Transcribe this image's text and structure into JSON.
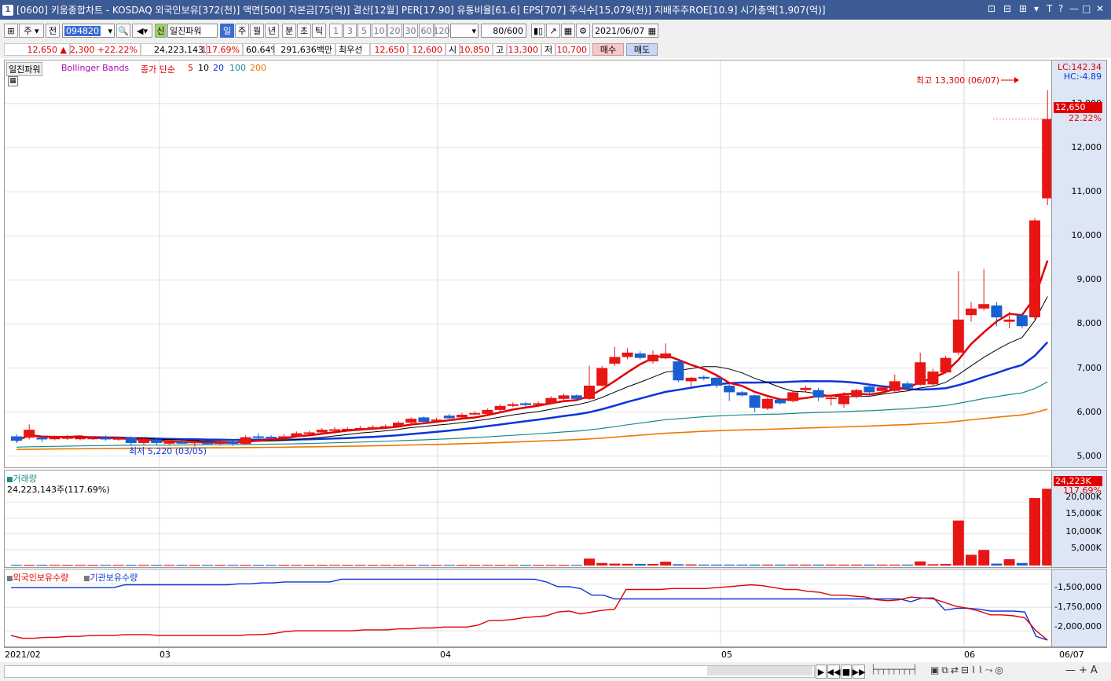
{
  "window": {
    "num": "1",
    "title": "[0600] 키움종합차트 - KOSDAQ 외국인보유[372(천)] 액면[500] 자본금[75(억)] 결산[12월] PER[17.90] 유통비율[61.6] EPS[707] 주식수[15,079(천)] 지배주주ROE[10.9] 시가총액[1,907(억)]",
    "controls": [
      "⊡",
      "⊟",
      "⊞",
      "▾",
      "T",
      "?",
      "—",
      "□",
      "✕"
    ]
  },
  "toolbar": {
    "market": "주",
    "prev": "전",
    "code": "094820",
    "shin": "신",
    "indicator": "일진파워",
    "periods": [
      "일",
      "주",
      "월",
      "년",
      "분",
      "초",
      "틱"
    ],
    "selected_period": "일",
    "nums": [
      "1",
      "3",
      "5",
      "10",
      "20",
      "30",
      "60",
      "120"
    ],
    "count": "80/600",
    "date": "2021/06/07"
  },
  "info": {
    "price": "12,650",
    "arrow": "▲",
    "change": "2,300",
    "rate": "+22.22%",
    "volume": "24,223,143",
    "vol_rate": "117.69%",
    "ratio": "60.64%",
    "amount": "291,636백만",
    "best_label": "최우선",
    "bid": "12,650",
    "ask": "12,600",
    "open_label": "시",
    "open": "10,850",
    "high_label": "고",
    "high": "13,300",
    "low_label": "저",
    "low": "10,700",
    "buy": "매수",
    "sell": "매도"
  },
  "price_panel": {
    "legend_name": "일진파워",
    "bb": "Bollinger Bands",
    "ma_label": "종가 단순",
    "ma_periods": [
      "5",
      "10",
      "20",
      "100",
      "200"
    ],
    "ma_colors": [
      "#e00000",
      "#000000",
      "#0a35d8",
      "#1a8a8a",
      "#ee7700"
    ],
    "lc": "LC:142.34",
    "hc": "HC:-4.89",
    "high_note": "최고 13,300 (06/07)",
    "low_note": "최저 5,220 (03/05)",
    "last_price": "12,650",
    "last_rate": "22.22%"
  },
  "volume_panel": {
    "title": "거래량",
    "value": "24,223,143주(117.69%)",
    "last": "24,223K",
    "last_rate": "117.69%",
    "ticks": [
      "20,000K",
      "15,000K",
      "10,000K",
      "5,000K"
    ]
  },
  "holding_panel": {
    "foreign_label": "외국인보유수량",
    "inst_label": "기관보유수량",
    "ticks": [
      "-1,500,000",
      "-1,750,000",
      "-2,000,000"
    ]
  },
  "x_labels": [
    "2021/02",
    "03",
    "04",
    "05",
    "06",
    "06/07"
  ],
  "chart_data": {
    "type": "candlestick",
    "y_ticks": [
      13000,
      12000,
      11000,
      10000,
      9000,
      8000,
      7000,
      6000,
      5000
    ],
    "ylim": [
      4800,
      13800
    ],
    "candles": [
      {
        "o": 5450,
        "c": 5350,
        "h": 5500,
        "l": 5300
      },
      {
        "o": 5420,
        "c": 5600,
        "h": 5720,
        "l": 5380
      },
      {
        "o": 5420,
        "c": 5380,
        "h": 5460,
        "l": 5320
      },
      {
        "o": 5400,
        "c": 5420,
        "h": 5470,
        "l": 5360
      },
      {
        "o": 5400,
        "c": 5430,
        "h": 5480,
        "l": 5370
      },
      {
        "o": 5400,
        "c": 5420,
        "h": 5470,
        "l": 5360
      },
      {
        "o": 5400,
        "c": 5420,
        "h": 5460,
        "l": 5370
      },
      {
        "o": 5420,
        "c": 5380,
        "h": 5470,
        "l": 5350
      },
      {
        "o": 5380,
        "c": 5410,
        "h": 5440,
        "l": 5350
      },
      {
        "o": 5420,
        "c": 5300,
        "h": 5450,
        "l": 5250
      },
      {
        "o": 5300,
        "c": 5380,
        "h": 5420,
        "l": 5260
      },
      {
        "o": 5380,
        "c": 5300,
        "h": 5420,
        "l": 5260
      },
      {
        "o": 5300,
        "c": 5320,
        "h": 5360,
        "l": 5250
      },
      {
        "o": 5320,
        "c": 5300,
        "h": 5360,
        "l": 5280
      },
      {
        "o": 5300,
        "c": 5330,
        "h": 5360,
        "l": 5220
      },
      {
        "o": 5310,
        "c": 5300,
        "h": 5340,
        "l": 5260
      },
      {
        "o": 5280,
        "c": 5320,
        "h": 5360,
        "l": 5250
      },
      {
        "o": 5320,
        "c": 5280,
        "h": 5350,
        "l": 5240
      },
      {
        "o": 5280,
        "c": 5430,
        "h": 5470,
        "l": 5260
      },
      {
        "o": 5450,
        "c": 5420,
        "h": 5520,
        "l": 5380
      },
      {
        "o": 5440,
        "c": 5430,
        "h": 5480,
        "l": 5400
      },
      {
        "o": 5420,
        "c": 5450,
        "h": 5500,
        "l": 5390
      },
      {
        "o": 5450,
        "c": 5520,
        "h": 5560,
        "l": 5430
      },
      {
        "o": 5520,
        "c": 5540,
        "h": 5580,
        "l": 5480
      },
      {
        "o": 5540,
        "c": 5600,
        "h": 5640,
        "l": 5520
      },
      {
        "o": 5600,
        "c": 5610,
        "h": 5660,
        "l": 5560
      },
      {
        "o": 5610,
        "c": 5620,
        "h": 5660,
        "l": 5580
      },
      {
        "o": 5620,
        "c": 5640,
        "h": 5690,
        "l": 5590
      },
      {
        "o": 5640,
        "c": 5660,
        "h": 5700,
        "l": 5610
      },
      {
        "o": 5660,
        "c": 5680,
        "h": 5720,
        "l": 5630
      },
      {
        "o": 5680,
        "c": 5760,
        "h": 5800,
        "l": 5650
      },
      {
        "o": 5760,
        "c": 5850,
        "h": 5880,
        "l": 5730
      },
      {
        "o": 5880,
        "c": 5780,
        "h": 5900,
        "l": 5740
      },
      {
        "o": 5800,
        "c": 5830,
        "h": 5870,
        "l": 5770
      },
      {
        "o": 5920,
        "c": 5860,
        "h": 5960,
        "l": 5820
      },
      {
        "o": 5880,
        "c": 5940,
        "h": 5980,
        "l": 5860
      },
      {
        "o": 5960,
        "c": 5980,
        "h": 6020,
        "l": 5930
      },
      {
        "o": 5960,
        "c": 6050,
        "h": 6080,
        "l": 5940
      },
      {
        "o": 6050,
        "c": 6140,
        "h": 6180,
        "l": 6010
      },
      {
        "o": 6140,
        "c": 6180,
        "h": 6220,
        "l": 6110
      },
      {
        "o": 6200,
        "c": 6160,
        "h": 6230,
        "l": 6120
      },
      {
        "o": 6180,
        "c": 6200,
        "h": 6240,
        "l": 6150
      },
      {
        "o": 6200,
        "c": 6320,
        "h": 6360,
        "l": 6180
      },
      {
        "o": 6300,
        "c": 6380,
        "h": 6420,
        "l": 6270
      },
      {
        "o": 6380,
        "c": 6300,
        "h": 6400,
        "l": 6250
      },
      {
        "o": 6300,
        "c": 6600,
        "h": 7050,
        "l": 6280
      },
      {
        "o": 6600,
        "c": 7000,
        "h": 7050,
        "l": 6580
      },
      {
        "o": 7100,
        "c": 7250,
        "h": 7480,
        "l": 7050
      },
      {
        "o": 7250,
        "c": 7350,
        "h": 7450,
        "l": 7200
      },
      {
        "o": 7330,
        "c": 7230,
        "h": 7380,
        "l": 7200
      },
      {
        "o": 7150,
        "c": 7300,
        "h": 7400,
        "l": 7100
      },
      {
        "o": 7220,
        "c": 7330,
        "h": 7560,
        "l": 7200
      },
      {
        "o": 7150,
        "c": 6720,
        "h": 7180,
        "l": 6680
      },
      {
        "o": 6700,
        "c": 6780,
        "h": 6800,
        "l": 6580
      },
      {
        "o": 6800,
        "c": 6760,
        "h": 6830,
        "l": 6720
      },
      {
        "o": 6780,
        "c": 6600,
        "h": 6820,
        "l": 6550
      },
      {
        "o": 6600,
        "c": 6450,
        "h": 6640,
        "l": 6250
      },
      {
        "o": 6450,
        "c": 6380,
        "h": 6480,
        "l": 6350
      },
      {
        "o": 6380,
        "c": 6100,
        "h": 6400,
        "l": 6000
      },
      {
        "o": 6080,
        "c": 6300,
        "h": 6330,
        "l": 6050
      },
      {
        "o": 6280,
        "c": 6200,
        "h": 6320,
        "l": 6170
      },
      {
        "o": 6250,
        "c": 6450,
        "h": 6500,
        "l": 6220
      },
      {
        "o": 6500,
        "c": 6550,
        "h": 6600,
        "l": 6450
      },
      {
        "o": 6500,
        "c": 6330,
        "h": 6550,
        "l": 6250
      },
      {
        "o": 6320,
        "c": 6330,
        "h": 6400,
        "l": 6150
      },
      {
        "o": 6180,
        "c": 6380,
        "h": 6450,
        "l": 6100
      },
      {
        "o": 6350,
        "c": 6500,
        "h": 6530,
        "l": 6320
      },
      {
        "o": 6580,
        "c": 6450,
        "h": 6620,
        "l": 6400
      },
      {
        "o": 6480,
        "c": 6560,
        "h": 6600,
        "l": 6420
      },
      {
        "o": 6480,
        "c": 6700,
        "h": 6850,
        "l": 6430
      },
      {
        "o": 6650,
        "c": 6550,
        "h": 6700,
        "l": 6500
      },
      {
        "o": 6620,
        "c": 7130,
        "h": 7350,
        "l": 6600
      },
      {
        "o": 6630,
        "c": 6920,
        "h": 6980,
        "l": 6600
      },
      {
        "o": 6900,
        "c": 7230,
        "h": 7280,
        "l": 6880
      },
      {
        "o": 7350,
        "c": 8100,
        "h": 9200,
        "l": 7300
      },
      {
        "o": 8200,
        "c": 8350,
        "h": 8500,
        "l": 8050
      },
      {
        "o": 8350,
        "c": 8450,
        "h": 9250,
        "l": 8300
      },
      {
        "o": 8420,
        "c": 8150,
        "h": 8500,
        "l": 7950
      },
      {
        "o": 8050,
        "c": 8100,
        "h": 8280,
        "l": 7900
      },
      {
        "o": 8200,
        "c": 7950,
        "h": 8250,
        "l": 7900
      },
      {
        "o": 8150,
        "c": 10350,
        "h": 10400,
        "l": 8100
      },
      {
        "o": 10850,
        "c": 12650,
        "h": 13300,
        "l": 10700
      }
    ],
    "volume": [
      250,
      250,
      250,
      250,
      250,
      250,
      250,
      250,
      250,
      250,
      250,
      250,
      250,
      250,
      250,
      250,
      250,
      250,
      250,
      250,
      250,
      250,
      250,
      250,
      250,
      250,
      250,
      250,
      250,
      250,
      250,
      250,
      250,
      250,
      250,
      250,
      250,
      250,
      250,
      250,
      250,
      250,
      250,
      250,
      250,
      2200,
      800,
      600,
      550,
      500,
      500,
      1200,
      400,
      350,
      300,
      300,
      300,
      300,
      300,
      300,
      300,
      300,
      300,
      300,
      300,
      300,
      300,
      300,
      300,
      300,
      300,
      1300,
      400,
      500,
      14200,
      3400,
      4900,
      600,
      2000,
      800,
      21300,
      24223
    ],
    "foreign_line": [
      -2050,
      -2080,
      -2080,
      -2070,
      -2070,
      -2060,
      -2060,
      -2050,
      -2050,
      -2050,
      -2040,
      -2040,
      -2040,
      -2050,
      -2050,
      -2050,
      -2050,
      -2050,
      -2050,
      -2050,
      -2050,
      -2040,
      -2040,
      -2030,
      -2010,
      -2000,
      -2000,
      -2000,
      -2000,
      -2000,
      -2000,
      -1990,
      -1990,
      -1990,
      -1980,
      -1980,
      -1970,
      -1970,
      -1960,
      -1960,
      -1960,
      -1940,
      -1890,
      -1890,
      -1880,
      -1860,
      -1850,
      -1840,
      -1800,
      -1790,
      -1820,
      -1800,
      -1780,
      -1770,
      -1560,
      -1560,
      -1560,
      -1560,
      -1550,
      -1550,
      -1550,
      -1550,
      -1540,
      -1530,
      -1520,
      -1510,
      -1520,
      -1540,
      -1560,
      -1560,
      -1580,
      -1590,
      -1620,
      -1620,
      -1630,
      -1640,
      -1670,
      -1680,
      -1670,
      -1640,
      -1650,
      -1660,
      -1700,
      -1740,
      -1760,
      -1790,
      -1830,
      -1830,
      -1840,
      -1860,
      -2000,
      -2100
    ],
    "inst_line": [
      -1540,
      -1540,
      -1540,
      -1540,
      -1540,
      -1540,
      -1540,
      -1540,
      -1540,
      -1540,
      -1510,
      -1510,
      -1510,
      -1510,
      -1510,
      -1510,
      -1510,
      -1510,
      -1510,
      -1510,
      -1500,
      -1500,
      -1490,
      -1490,
      -1480,
      -1480,
      -1480,
      -1480,
      -1480,
      -1450,
      -1450,
      -1450,
      -1450,
      -1450,
      -1450,
      -1450,
      -1450,
      -1450,
      -1450,
      -1450,
      -1450,
      -1450,
      -1450,
      -1450,
      -1450,
      -1450,
      -1450,
      -1480,
      -1530,
      -1530,
      -1550,
      -1620,
      -1620,
      -1660,
      -1660,
      -1660,
      -1660,
      -1660,
      -1660,
      -1660,
      -1660,
      -1660,
      -1660,
      -1660,
      -1660,
      -1660,
      -1660,
      -1660,
      -1660,
      -1660,
      -1660,
      -1660,
      -1660,
      -1660,
      -1660,
      -1660,
      -1660,
      -1660,
      -1660,
      -1690,
      -1650,
      -1650,
      -1780,
      -1760,
      -1760,
      -1770,
      -1790,
      -1790,
      -1790,
      -1800,
      -2060,
      -2100
    ]
  }
}
